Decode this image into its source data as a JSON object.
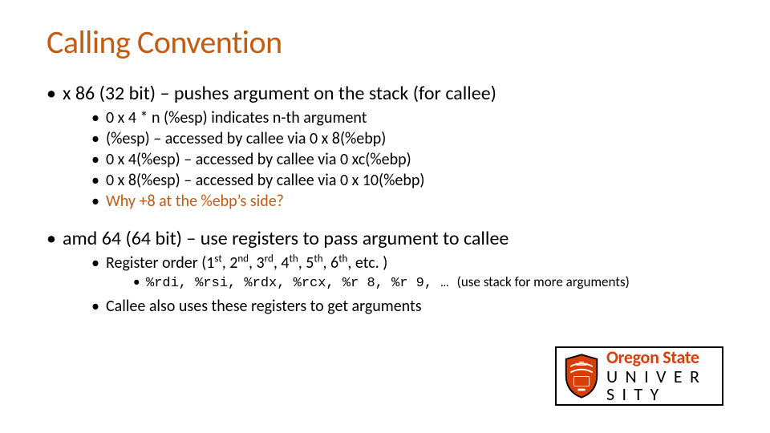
{
  "title": "Calling Convention",
  "x86": {
    "heading": "x 86 (32 bit) – pushes argument on the stack (for callee)",
    "items": [
      "0 x 4 * n (%esp) indicates n-th argument",
      "(%esp) – accessed by callee via 0 x 8(%ebp)",
      "0 x 4(%esp) – accessed by callee via 0 xc(%ebp)",
      "0 x 8(%esp) – accessed by callee via 0 x 10(%ebp)"
    ],
    "question": " Why +8 at the %ebp’s side?"
  },
  "amd64": {
    "heading": "amd 64 (64 bit) – use registers to pass argument to callee",
    "order_prefix": "Register order (1",
    "order_mid2": ", 2",
    "order_mid3": ", 3",
    "order_mid4": ", 4",
    "order_mid5": ", 5",
    "order_mid6": ", 6",
    "order_suffix": ", etc. )",
    "sup1": "st",
    "sup2": "nd",
    "sup3": "rd",
    "sup4": "th",
    "sup5": "th",
    "sup6": "th",
    "registers_code": "%rdi, %rsi, %rdx, %rcx, %r 8, %r 9, … ",
    "registers_tail": "(use stack for more arguments)",
    "callee_note": "Callee also uses these registers to get arguments"
  },
  "logo": {
    "line1": "Oregon State",
    "line2": "U N I V E R S I T Y"
  }
}
